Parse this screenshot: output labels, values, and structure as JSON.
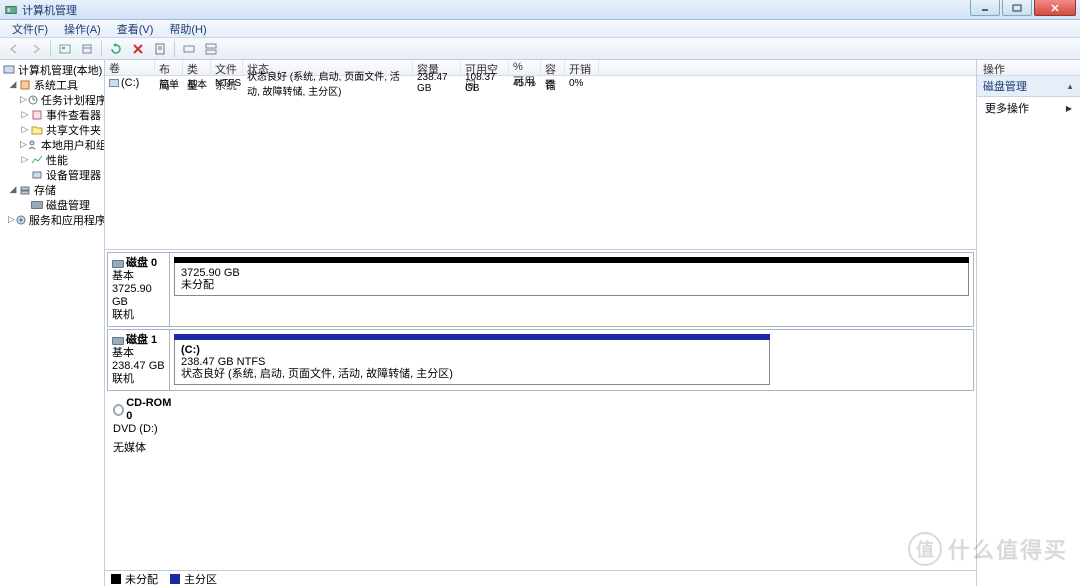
{
  "window": {
    "title": "计算机管理"
  },
  "menu": {
    "file": "文件(F)",
    "action": "操作(A)",
    "view": "查看(V)",
    "help": "帮助(H)"
  },
  "tree": {
    "root": "计算机管理(本地)",
    "systools": "系统工具",
    "task": "任务计划程序",
    "event": "事件查看器",
    "shared": "共享文件夹",
    "users": "本地用户和组",
    "perf": "性能",
    "devmgr": "设备管理器",
    "storage": "存储",
    "diskmgmt": "磁盘管理",
    "services": "服务和应用程序"
  },
  "vol_headers": {
    "vol": "卷",
    "layout": "布局",
    "type": "类型",
    "fs": "文件系统",
    "status": "状态",
    "cap": "容量",
    "free": "可用空间",
    "pct": "% 可用",
    "fault": "容错",
    "over": "开销"
  },
  "volumes": [
    {
      "name": "(C:)",
      "layout": "简单",
      "type": "基本",
      "fs": "NTFS",
      "status": "状态良好 (系统, 启动, 页面文件, 活动, 故障转储, 主分区)",
      "cap": "238.47 GB",
      "free": "108.37 GB",
      "pct": "45 %",
      "fault": "否",
      "over": "0%"
    }
  ],
  "disks": {
    "d0": {
      "name": "磁盘 0",
      "type": "基本",
      "size": "3725.90 GB",
      "status": "联机",
      "part_size": "3725.90 GB",
      "part_status": "未分配"
    },
    "d1": {
      "name": "磁盘 1",
      "type": "基本",
      "size": "238.47 GB",
      "status": "联机",
      "part_label": "(C:)",
      "part_size": "238.47 GB NTFS",
      "part_status": "状态良好 (系统, 启动, 页面文件, 活动, 故障转储, 主分区)"
    },
    "cd": {
      "name": "CD-ROM 0",
      "label": "DVD (D:)",
      "status": "无媒体"
    }
  },
  "legend": {
    "unalloc": "未分配",
    "primary": "主分区"
  },
  "actions": {
    "header": "操作",
    "section": "磁盘管理",
    "more": "更多操作"
  },
  "watermark": {
    "glyph": "值",
    "text": "什么值得买"
  }
}
